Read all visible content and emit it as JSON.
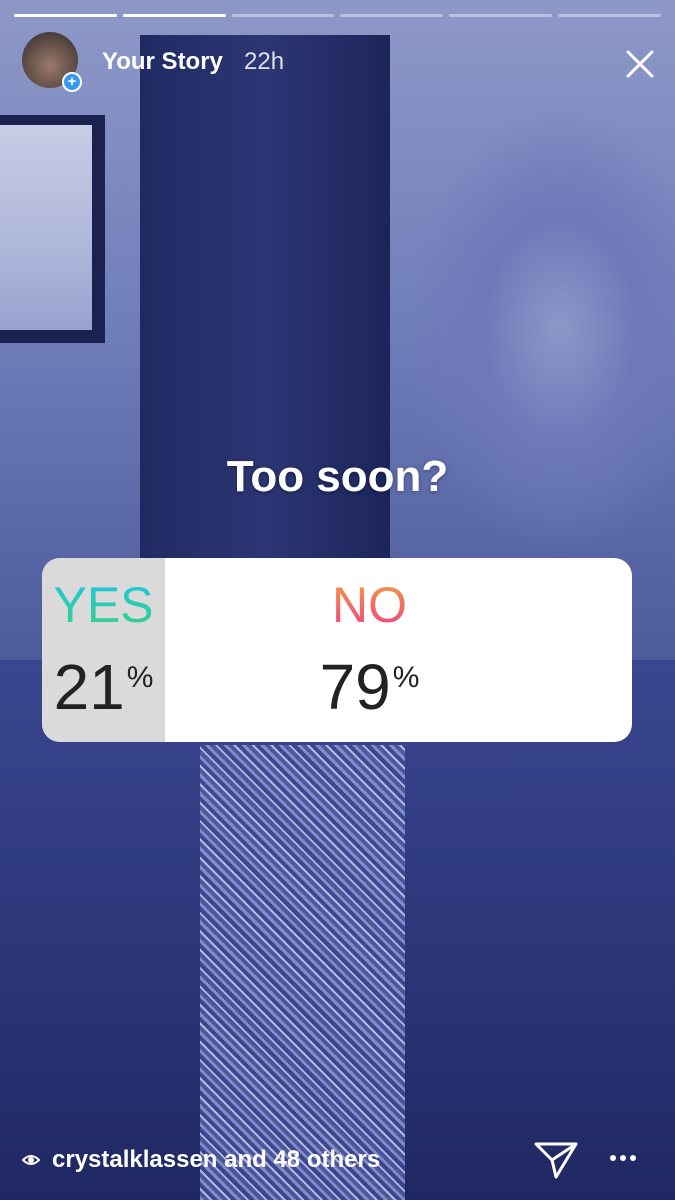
{
  "story": {
    "title": "Your Story",
    "time": "22h",
    "segments_total": 6,
    "segments_viewed": 2
  },
  "poll": {
    "question": "Too soon?",
    "options": [
      {
        "label": "YES",
        "percent": 21,
        "unit": "%"
      },
      {
        "label": "NO",
        "percent": 79,
        "unit": "%"
      }
    ]
  },
  "footer": {
    "viewers": "crystalklassen and 48 others"
  },
  "colors": {
    "yes_gradient": [
      "#19c6e6",
      "#3ed07a"
    ],
    "no_gradient": [
      "#f7a13c",
      "#ec3c8a"
    ],
    "add_badge": "#3897f0"
  },
  "icons": [
    "add-icon",
    "close-icon",
    "eye-icon",
    "send-icon",
    "more-icon"
  ]
}
